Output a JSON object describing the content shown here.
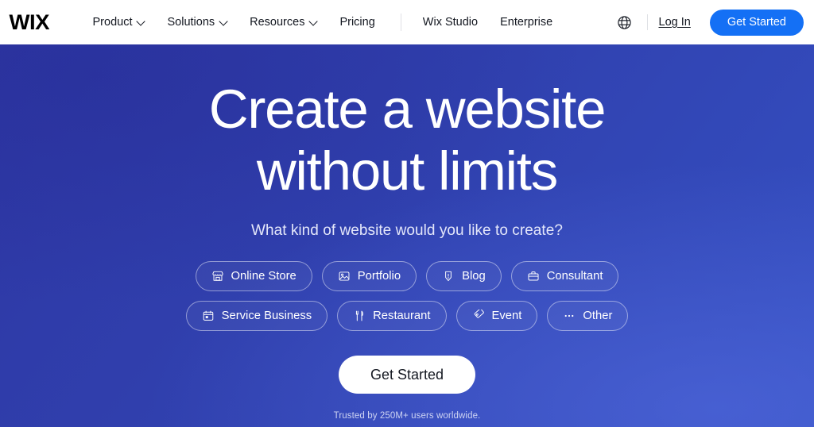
{
  "header": {
    "logo": "WIX",
    "nav": [
      {
        "label": "Product",
        "icon": "chevron-down-icon",
        "has_chevron": true
      },
      {
        "label": "Solutions",
        "icon": "chevron-down-icon",
        "has_chevron": true
      },
      {
        "label": "Resources",
        "icon": "chevron-down-icon",
        "has_chevron": true
      },
      {
        "label": "Pricing",
        "has_chevron": false
      },
      {
        "label": "Wix Studio",
        "has_chevron": false
      },
      {
        "label": "Enterprise",
        "has_chevron": false
      }
    ],
    "language_icon": "globe-icon",
    "login_label": "Log In",
    "cta_label": "Get Started",
    "cta_color": "#1470F5"
  },
  "hero": {
    "headline_line1": "Create a website",
    "headline_line2": "without limits",
    "subheading": "What kind of website would you like to create?",
    "cta_label": "Get Started",
    "trusted_text": "Trusted by 250M+ users worldwide.",
    "background_from": "#2E37A4",
    "background_to": "#3550C2",
    "chips_row1": [
      {
        "label": "Online Store",
        "icon": "storefront-icon"
      },
      {
        "label": "Portfolio",
        "icon": "image-icon"
      },
      {
        "label": "Blog",
        "icon": "pen-icon"
      },
      {
        "label": "Consultant",
        "icon": "briefcase-icon"
      }
    ],
    "chips_row2": [
      {
        "label": "Service Business",
        "icon": "calendar-icon"
      },
      {
        "label": "Restaurant",
        "icon": "fork-knife-icon"
      },
      {
        "label": "Event",
        "icon": "ticket-icon"
      },
      {
        "label": "Other",
        "icon": "ellipsis-icon"
      }
    ]
  }
}
